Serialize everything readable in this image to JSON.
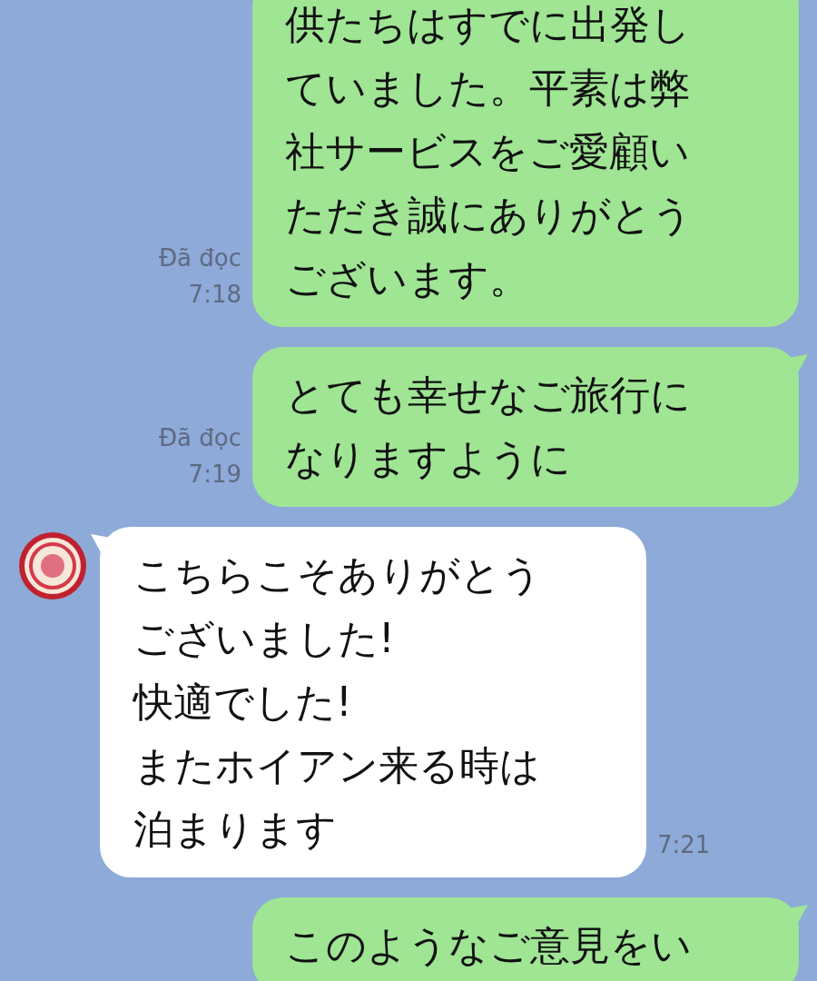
{
  "messages": [
    {
      "kind": "sent",
      "text": "供たちはすでに出発していました。平素は弊社サービスをご愛顧いただき誠にありがとうございます。",
      "read_label": "Đã đọc",
      "time": "7:18"
    },
    {
      "kind": "sent",
      "text": "とても幸せなご旅行になりますように",
      "read_label": "Đã đọc",
      "time": "7:19"
    },
    {
      "kind": "received",
      "text": "こちらこそありがとうございました!\n快適でした!\nまたホイアン来る時は泊まります",
      "time": "7:21"
    },
    {
      "kind": "sent",
      "text": "このようなご意見をい"
    }
  ]
}
